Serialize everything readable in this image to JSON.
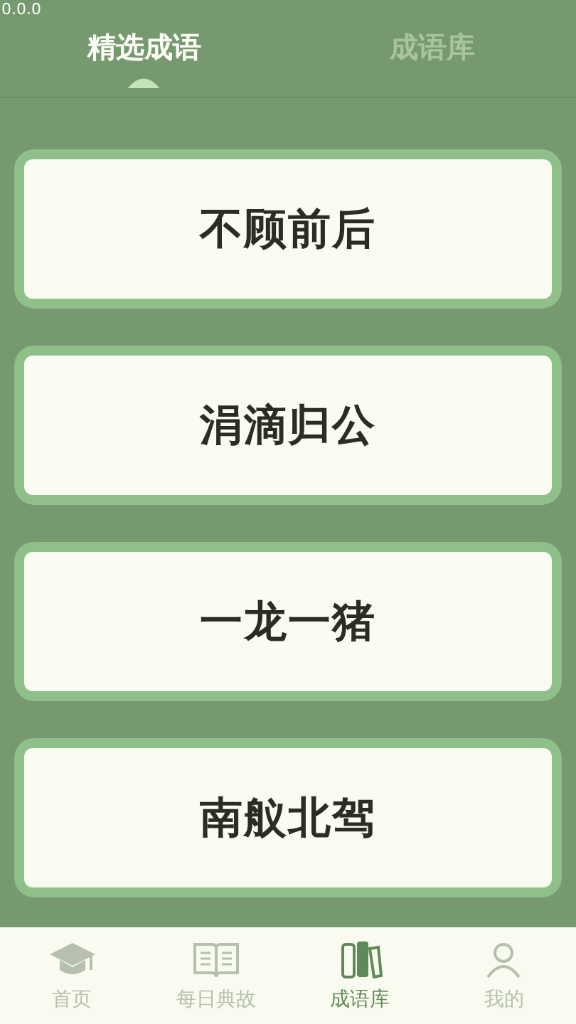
{
  "status_bar": {
    "text": "0.0.0"
  },
  "tabs": [
    {
      "label": "精选成语",
      "selected": true
    },
    {
      "label": "成语库",
      "selected": false
    }
  ],
  "idioms": [
    "不顾前后",
    "涓滴归公",
    "一龙一猪",
    "南舣北驾"
  ],
  "bottom_nav": [
    {
      "label": "首页",
      "kind": "cap",
      "selected": false
    },
    {
      "label": "每日典故",
      "kind": "book",
      "selected": false
    },
    {
      "label": "成语库",
      "kind": "books",
      "selected": true
    },
    {
      "label": "我的",
      "kind": "person",
      "selected": false
    }
  ]
}
